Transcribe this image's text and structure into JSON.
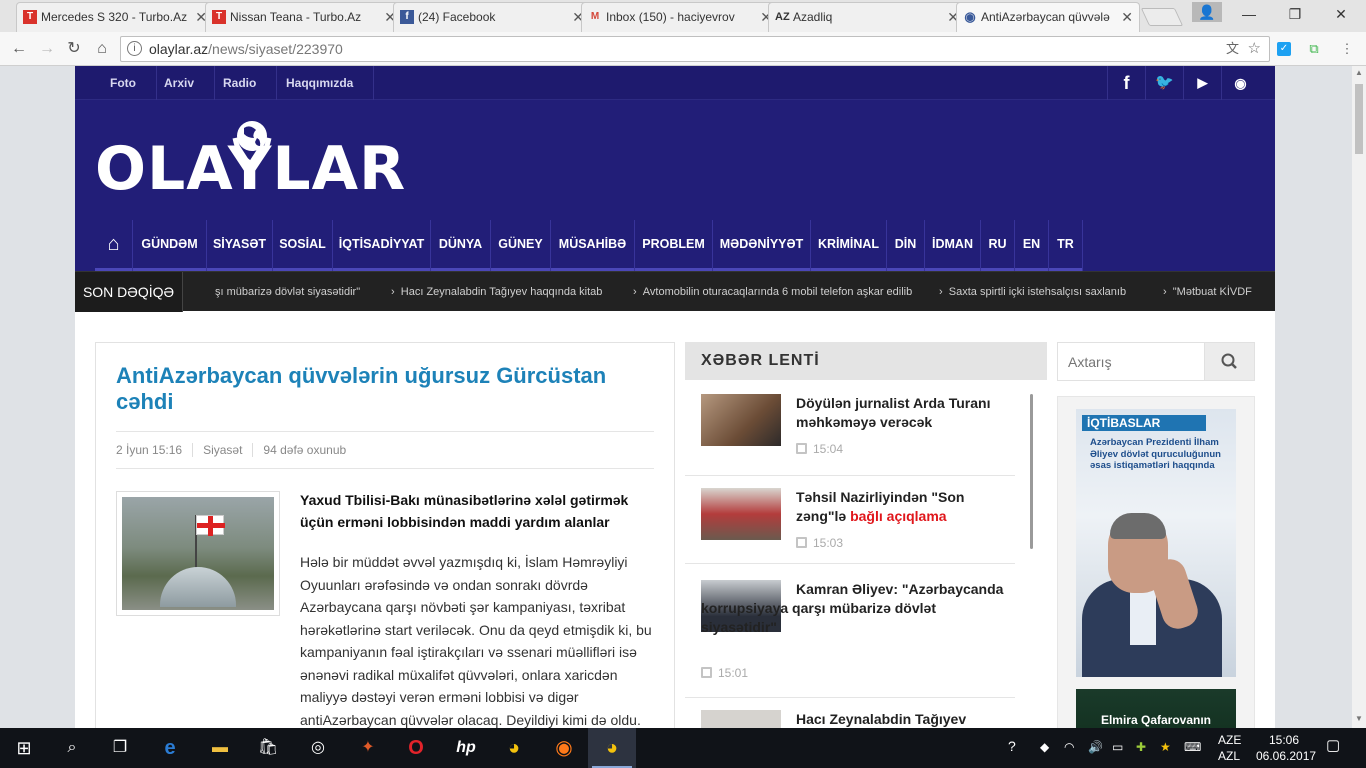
{
  "browser": {
    "tabs": [
      {
        "title": "Mercedes S 320 - Turbo.Az",
        "icon": "turbo-az-icon",
        "icon_text": "T",
        "color": "#d9322b"
      },
      {
        "title": "Nissan Teana - Turbo.Az",
        "icon": "turbo-az-icon",
        "icon_text": "T",
        "color": "#d9322b"
      },
      {
        "title": "(24) Facebook",
        "icon": "facebook-icon",
        "icon_text": "f",
        "color": "#3b5998"
      },
      {
        "title": "Inbox (150) - haciyevrov",
        "icon": "gmail-icon",
        "icon_text": "M",
        "color": "#d44638"
      },
      {
        "title": "Azadliq",
        "icon": "azadliq-icon",
        "icon_text": "AZ",
        "color": "#333333"
      },
      {
        "title": "AntiAzərbaycan qüvvələ",
        "icon": "globe-icon",
        "icon_text": "◉",
        "color": "#3a5a9a"
      }
    ],
    "url_host": "olaylar.az",
    "url_path": "/news/siyaset/223970"
  },
  "site": {
    "top_links": [
      "Foto",
      "Arxiv",
      "Radio",
      "Haqqımızda"
    ],
    "social": [
      {
        "name": "facebook-icon",
        "glyph": "f"
      },
      {
        "name": "twitter-icon",
        "glyph": "🐦"
      },
      {
        "name": "youtube-icon",
        "glyph": "▶"
      },
      {
        "name": "rss-icon",
        "glyph": "◉"
      }
    ],
    "logo": "OLAYLAR",
    "nav": [
      "GÜNDƏM",
      "SİYASƏT",
      "SOSİAL",
      "İQTİSADİYYAT",
      "DÜNYA",
      "GÜNEY",
      "MÜSAHİBƏ",
      "PROBLEM",
      "MƏDƏNİYYƏT",
      "KRİMİNAL",
      "DİN",
      "İDMAN",
      "RU",
      "EN",
      "TR"
    ],
    "son_deqiqe_label": "SON DƏQİQƏ",
    "ticker": [
      "şı mübarizə dövlət siyasətidir\"",
      "Hacı Zeynalabdin Tağıyev haqqında kitab",
      "Avtomobilin oturacaqlarında 6 mobil telefon aşkar edilib",
      "Saxta spirtli içki istehsalçısı saxlanıb",
      "\"Mətbuat KİVDF"
    ]
  },
  "article": {
    "title": "AntiAzərbaycan qüvvələrin uğursuz Gürcüstan cəhdi",
    "date": "2 İyun 15:16",
    "category": "Siyasət",
    "views": "94 dəfə oxunub",
    "lead": "Yaxud Tbilisi-Bakı münasibətlərinə xələl gətirmək üçün erməni lobbisindən maddi yardım alanlar",
    "body_p1": "Hələ bir müddət əvvəl yazmışdıq ki, İslam Həmrəyliyi Oyuunları ərəfəsində və ondan sonrakı dövrdə Azərbaycana qarşı növbəti şər kampaniyası, təxribat hərəkətlərinə start veriləcək. Onu da qeyd etmişdik ki, bu kampaniyanın fəal iştirakçıları və ssenari müəllifləri isə ənənəvi radikal müxalifət qüvvələri, onlara xaricdən maliyyə dəstəyi verən erməni lobbisi və digər antiAzərbaycan qüvvələr olacaq. Deyildiyi kimi də oldu. Amma bu dəfə şər kampaniyası Azərbaycanı yaxın qonşularının əli ilə vurmağa çalışdı. Əvvəl Rusiya,"
  },
  "lenta": {
    "title": "XƏBƏR LENTİ",
    "items": [
      {
        "title": "Döyülən jurnalist Arda Turanı məhkəməyə verəcək",
        "title_red": "",
        "time": "15:04"
      },
      {
        "title": "Təhsil Nazirliyindən \"Son zəng\"lə ",
        "title_red": "bağlı açıqlama",
        "time": "15:03"
      },
      {
        "title": "Kamran Əliyev: \"Azərbaycanda korrupsiyaya qarşı mübarizə dövlət siyasətidir\"",
        "title_red": "",
        "time": "15:01"
      },
      {
        "title": "Hacı Zeynalabdin Tağıyev",
        "title_red": "",
        "time": ""
      }
    ]
  },
  "sidebar": {
    "search_placeholder": "Axtarış",
    "iqtibas_label": "İQTİBASLAR",
    "iqtibas_sub": "Azərbaycan Prezidenti İlham Əliyev dövlət quruculuğunun əsas istiqamətləri haqqında",
    "elmira": "Elmira Qafarovanın"
  },
  "taskbar": {
    "lang_top": "AZE",
    "lang_bottom": "AZL",
    "time": "15:06",
    "date": "06.06.2017"
  }
}
